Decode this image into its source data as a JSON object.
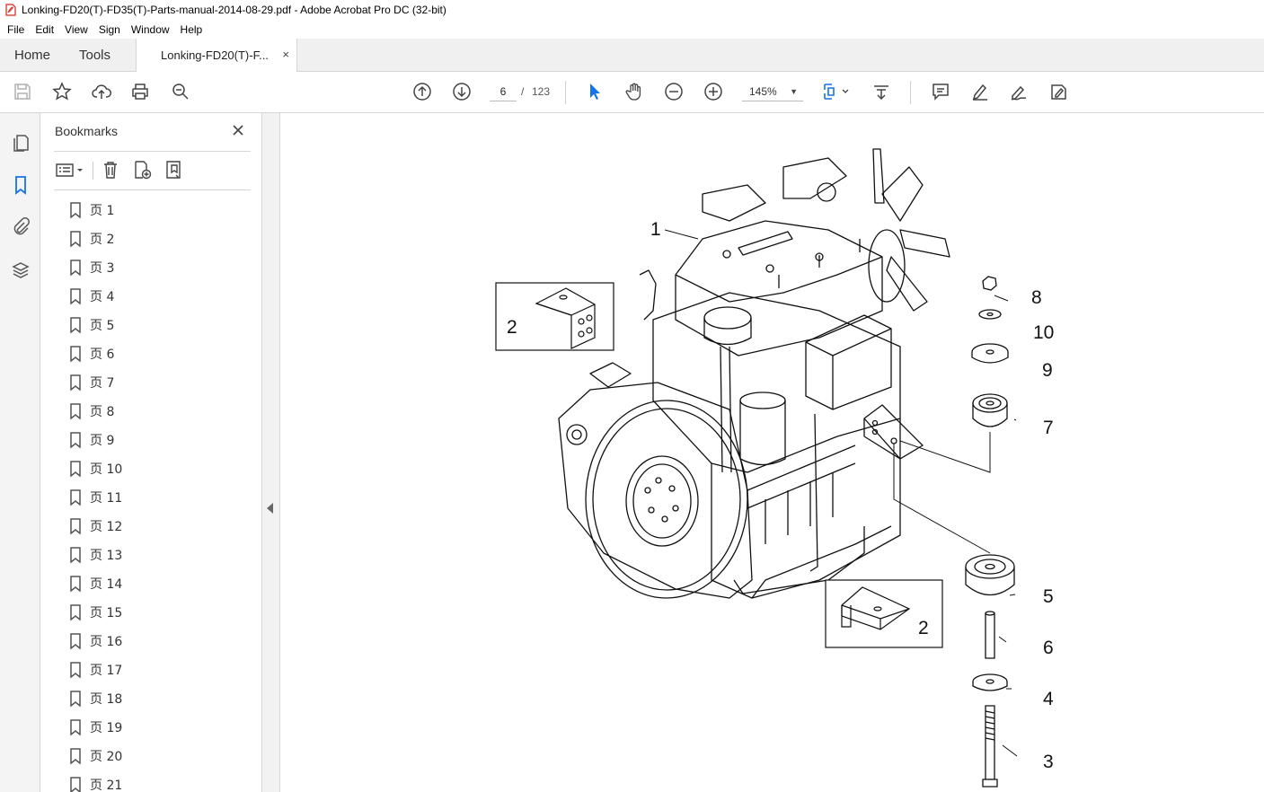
{
  "window": {
    "title": "Lonking-FD20(T)-FD35(T)-Parts-manual-2014-08-29.pdf - Adobe Acrobat Pro DC (32-bit)"
  },
  "menu": [
    "File",
    "Edit",
    "View",
    "Sign",
    "Window",
    "Help"
  ],
  "tabs": {
    "home": "Home",
    "tools": "Tools",
    "document": "Lonking-FD20(T)-F...",
    "close": "×"
  },
  "toolbar": {
    "page_current": "6",
    "page_separator": "/",
    "page_total": "123",
    "zoom": "145%",
    "zoom_dropdown": "▼"
  },
  "bookmarks": {
    "title": "Bookmarks",
    "close": "×",
    "items": [
      "页 1",
      "页 2",
      "页 3",
      "页 4",
      "页 5",
      "页 6",
      "页 7",
      "页 8",
      "页 9",
      "页 10",
      "页 11",
      "页 12",
      "页 13",
      "页 14",
      "页 15",
      "页 16",
      "页 17",
      "页 18",
      "页 19",
      "页 20",
      "页 21"
    ]
  },
  "drawing": {
    "callouts": [
      "1",
      "2",
      "2",
      "8",
      "10",
      "9",
      "7",
      "5",
      "6",
      "4",
      "3"
    ]
  },
  "colors": {
    "accent": "#1473e6",
    "icon": "#444444",
    "panel_bg": "#f4f4f4"
  }
}
